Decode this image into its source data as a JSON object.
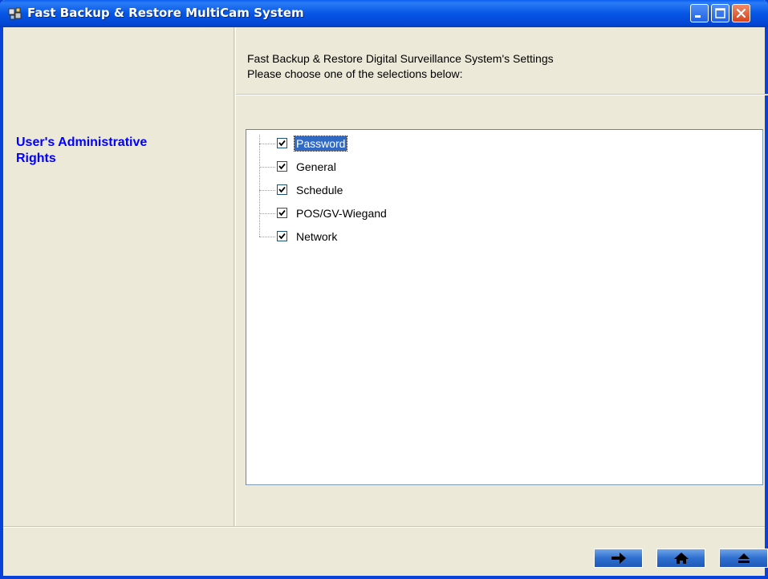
{
  "window": {
    "title": "Fast Backup & Restore MultiCam System",
    "titlebar_color": "#0656e6",
    "buttons": [
      "minimize-icon",
      "maximize-icon",
      "close-icon"
    ]
  },
  "sidebar": {
    "title": "User's Administrative Rights",
    "color": "#0000ff"
  },
  "main": {
    "header_line1": "Fast Backup & Restore Digital Surveillance System's Settings",
    "header_line2": "Please choose one of the selections below:",
    "tree_items": [
      {
        "label": "Password",
        "checked": true,
        "selected": true
      },
      {
        "label": "General",
        "checked": true,
        "selected": false
      },
      {
        "label": "Schedule",
        "checked": true,
        "selected": false
      },
      {
        "label": "POS/GV-Wiegand",
        "checked": true,
        "selected": false
      },
      {
        "label": "Network",
        "checked": true,
        "selected": false
      }
    ]
  },
  "footer": {
    "buttons": [
      {
        "icon": "arrow-right-icon"
      },
      {
        "icon": "home-icon"
      },
      {
        "icon": "eject-icon"
      }
    ]
  }
}
